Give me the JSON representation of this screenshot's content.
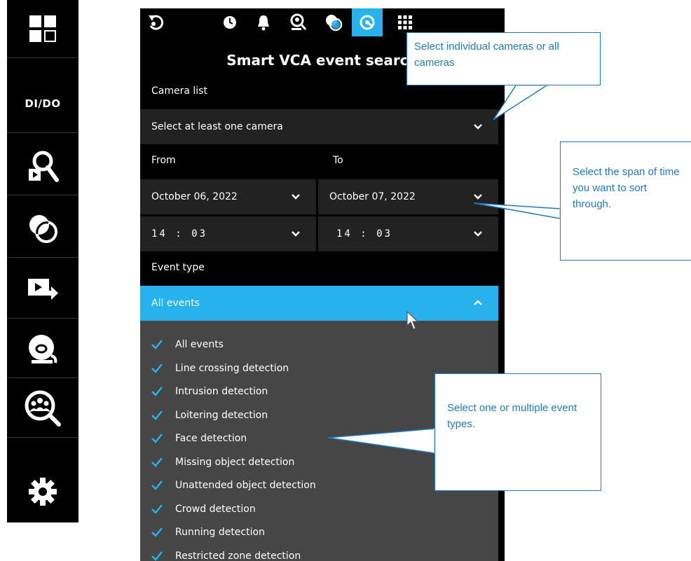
{
  "sidebar": {
    "items": [
      {
        "name": "layout-icon"
      },
      {
        "name": "dido",
        "label": "DI/DO"
      },
      {
        "name": "playback-search-icon"
      },
      {
        "name": "vca-icon"
      },
      {
        "name": "export-icon"
      },
      {
        "name": "alarm-icon"
      },
      {
        "name": "people-search-icon"
      },
      {
        "name": "gear-icon"
      }
    ]
  },
  "toolbar": {
    "icons": [
      "back-icon",
      "clock-icon",
      "bell-icon",
      "face-search-icon",
      "vca-icon",
      "smart-vca-icon",
      "grid-icon"
    ],
    "active": "smart-vca-icon",
    "accent": "#27b2ee"
  },
  "panel": {
    "title": "Smart VCA event search",
    "camera_list_label": "Camera list",
    "camera_placeholder": "Select at least one camera",
    "from_label": "From",
    "to_label": "To",
    "from_date": "October 06, 2022",
    "to_date": "October 07, 2022",
    "from_time": "14 : 03",
    "to_time": "14 : 03",
    "event_type_label": "Event type",
    "event_type_selected": "All events",
    "event_options": [
      "All events",
      "Line crossing detection",
      "Intrusion detection",
      "Loitering detection",
      "Face detection",
      "Missing object detection",
      "Unattended object detection",
      "Crowd detection",
      "Running detection",
      "Restricted zone detection"
    ]
  },
  "callouts": {
    "cameras": "Select individual cameras or all cameras",
    "timespan": "Select the span of time you want to sort through.",
    "events": "Select one or multiple event types."
  }
}
